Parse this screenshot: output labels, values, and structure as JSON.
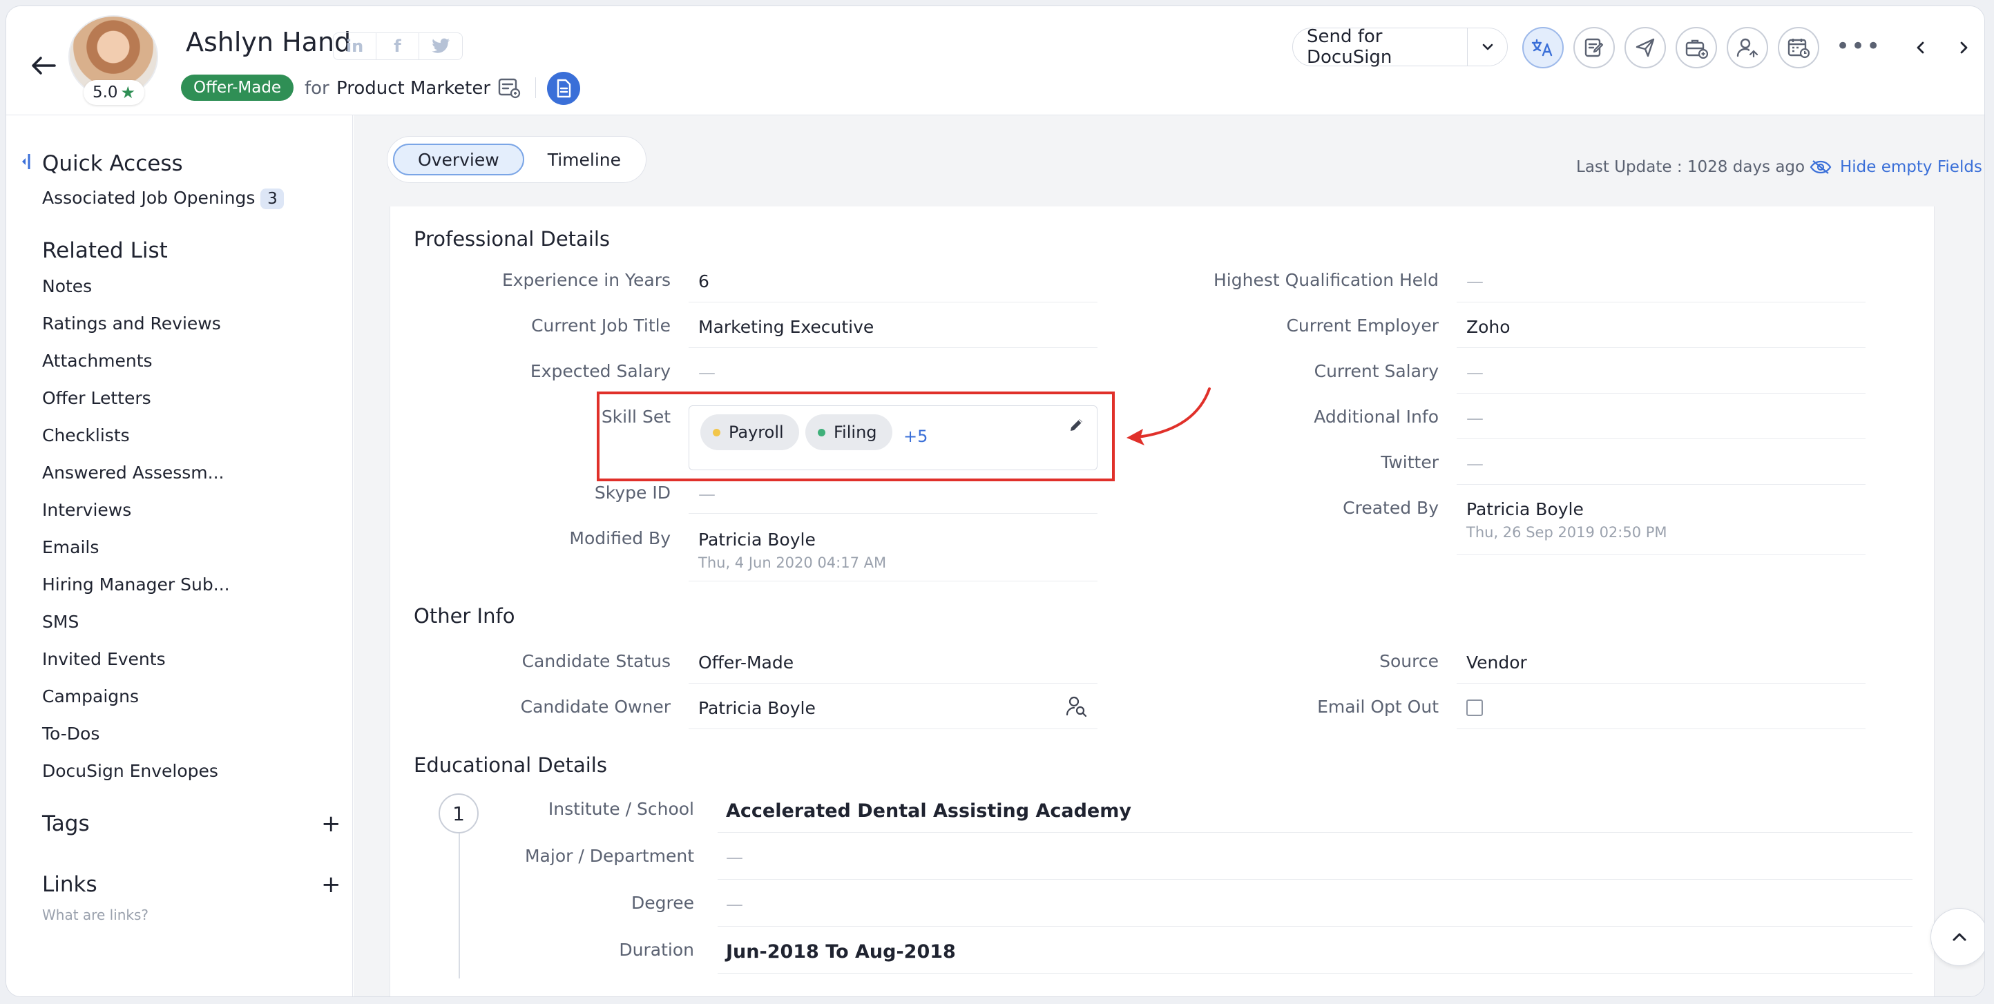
{
  "header": {
    "candidate_name": "Ashlyn Hand",
    "rating": "5.0",
    "socials": [
      "in",
      "f",
      "t"
    ],
    "status": "Offer-Made",
    "for_label": "for",
    "job_title": "Product Marketer",
    "docusign_label": "Send for DocuSign",
    "more": "•••"
  },
  "sidebar": {
    "quick_access_title": "Quick Access",
    "associated_label": "Associated Job Openings",
    "associated_count": "3",
    "related_title": "Related List",
    "related_items": [
      "Notes",
      "Ratings and Reviews",
      "Attachments",
      "Offer Letters",
      "Checklists",
      "Answered Assessm...",
      "Interviews",
      "Emails",
      "Hiring Manager Sub...",
      "SMS",
      "Invited Events",
      "Campaigns",
      "To-Dos",
      "DocuSign Envelopes"
    ],
    "tags_title": "Tags",
    "links_title": "Links",
    "links_hint": "What are links?"
  },
  "main": {
    "tabs": [
      "Overview",
      "Timeline"
    ],
    "last_update": "Last Update : 1028 days ago",
    "hide_empty": "Hide empty Fields",
    "professional": {
      "title": "Professional Details",
      "left": [
        {
          "label": "Experience in Years",
          "value": "6"
        },
        {
          "label": "Current Job Title",
          "value": "Marketing Executive"
        },
        {
          "label": "Expected Salary",
          "value": "—"
        },
        {
          "label": "Skill Set",
          "value": ""
        },
        {
          "label": "Skype ID",
          "value": "—"
        },
        {
          "label": "Modified By",
          "value": "Patricia Boyle",
          "sub": "Thu, 4 Jun 2020 04:17 AM"
        }
      ],
      "right": [
        {
          "label": "Highest Qualification Held",
          "value": "—"
        },
        {
          "label": "Current Employer",
          "value": "Zoho"
        },
        {
          "label": "Current Salary",
          "value": "—"
        },
        {
          "label": "Additional Info",
          "value": "—"
        },
        {
          "label": "Twitter",
          "value": "—"
        },
        {
          "label": "Created By",
          "value": "Patricia Boyle",
          "sub": "Thu, 26 Sep 2019 02:50 PM"
        }
      ],
      "skills": [
        "Payroll",
        "Filing"
      ],
      "skills_more": "+5",
      "skill_colors": [
        "#f2c64a",
        "#3fb07a"
      ]
    },
    "other": {
      "title": "Other Info",
      "left": [
        {
          "label": "Candidate Status",
          "value": "Offer-Made"
        },
        {
          "label": "Candidate Owner",
          "value": "Patricia Boyle"
        }
      ],
      "right": [
        {
          "label": "Source",
          "value": "Vendor"
        },
        {
          "label": "Email Opt Out",
          "value": ""
        }
      ]
    },
    "education": {
      "title": "Educational Details",
      "index": "1",
      "rows": [
        {
          "label": "Institute / School",
          "value": "Accelerated Dental Assisting Academy"
        },
        {
          "label": "Major / Department",
          "value": "—"
        },
        {
          "label": "Degree",
          "value": "—"
        },
        {
          "label": "Duration",
          "value": "Jun-2018 To Aug-2018"
        }
      ]
    }
  },
  "colors": {
    "accent": "#3a6fd8",
    "status_green": "#2f8f55",
    "highlight_red": "#e0302a"
  }
}
